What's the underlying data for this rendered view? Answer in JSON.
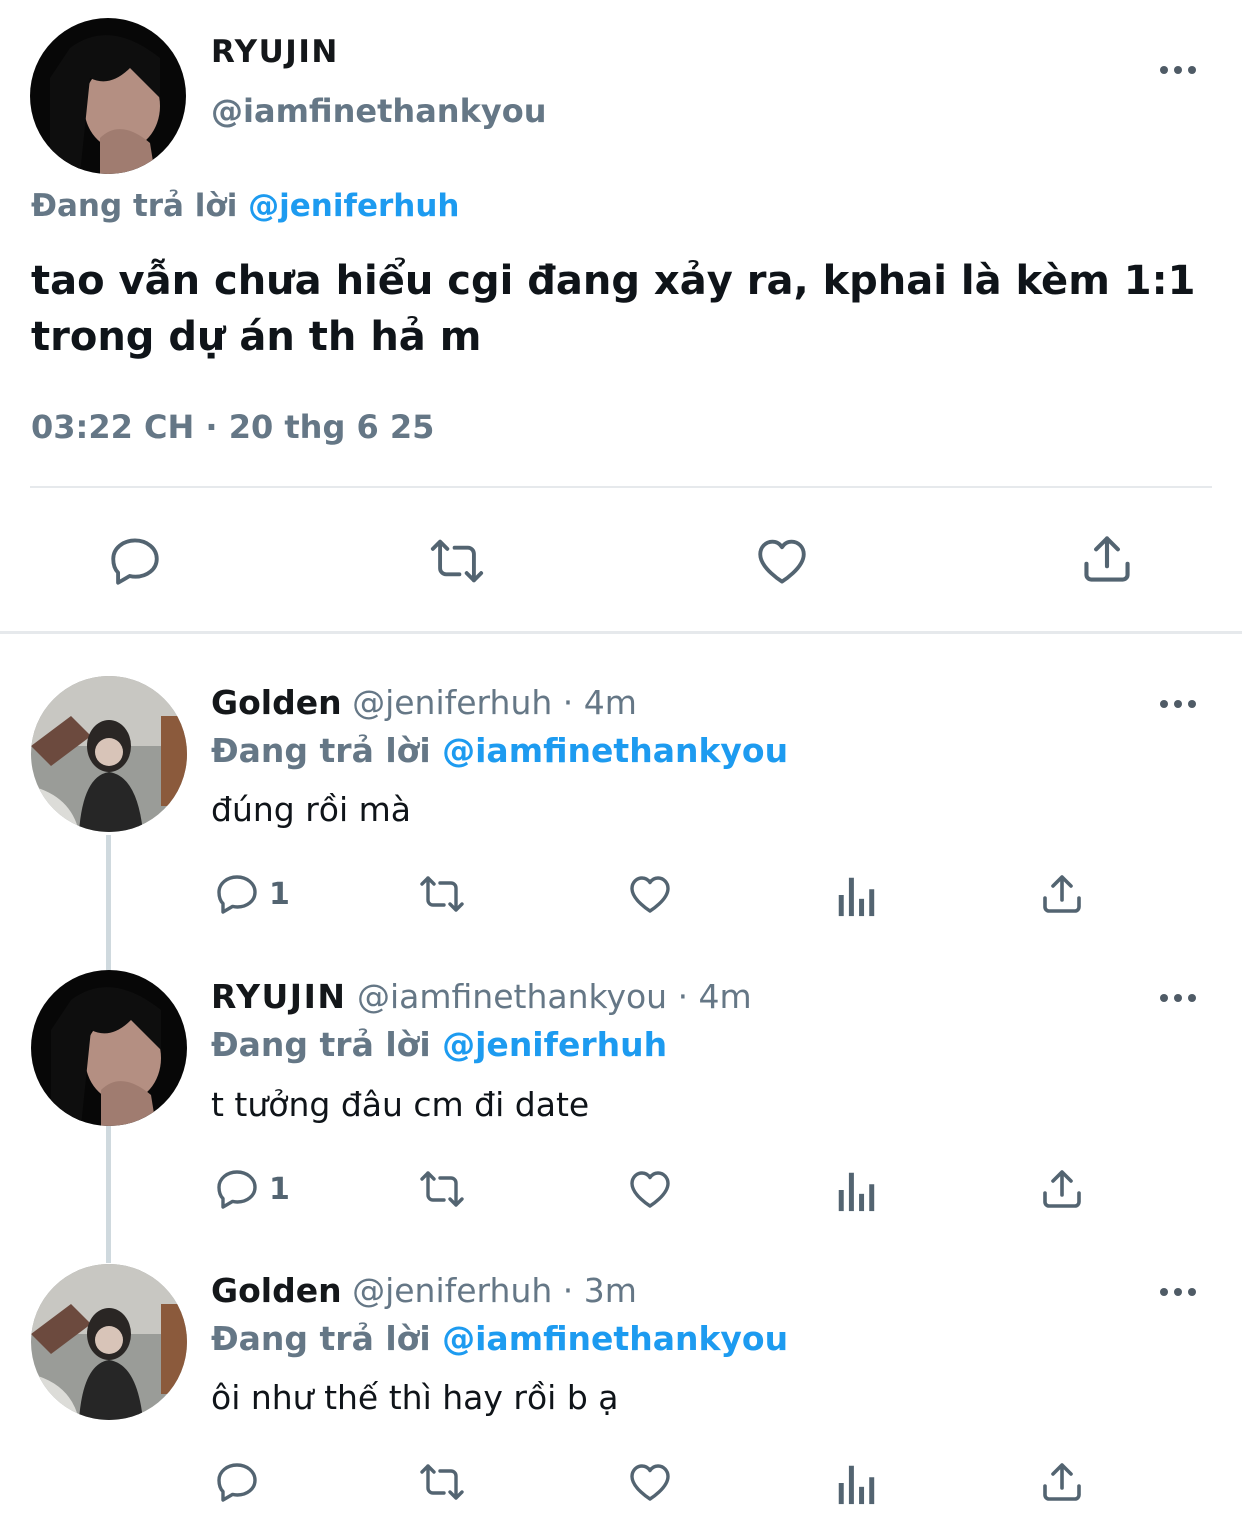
{
  "main_tweet": {
    "display_name": "RYUJIN",
    "handle": "@iamfinethankyou",
    "replying_prefix": "Đang trả lời",
    "replying_to": "@jeniferhuh",
    "text_line1": "tao vẫn chưa hiểu cgi đang xảy ra, kphai là kèm 1:1",
    "text_line2": "trong dự án th hả m",
    "timestamp": "03:22 CH · 20 thg 6 25"
  },
  "replies": [
    {
      "display_name": "Golden",
      "handle": "@jeniferhuh · 4m",
      "replying_prefix": "Đang trả lời",
      "replying_to": "@iamfinethankyou",
      "text": "đúng rồi mà",
      "reply_count": "1"
    },
    {
      "display_name": "RYUJIN",
      "handle": "@iamfinethankyou · 4m",
      "replying_prefix": "Đang trả lời",
      "replying_to": "@jeniferhuh",
      "text": "t tưởng đâu cm đi date",
      "reply_count": "1"
    },
    {
      "display_name": "Golden",
      "handle": "@jeniferhuh · 3m",
      "replying_prefix": "Đang trả lời",
      "replying_to": "@iamfinethankyou",
      "text": "ôi như thế thì hay rồi b ạ",
      "reply_count": ""
    }
  ],
  "colors": {
    "accent": "#1d9bf0",
    "icon": "#536471",
    "thread_line": "#cfd9de"
  },
  "icons": [
    "more-dots-icon",
    "reply-icon",
    "retweet-icon",
    "like-icon",
    "views-icon",
    "share-icon"
  ]
}
